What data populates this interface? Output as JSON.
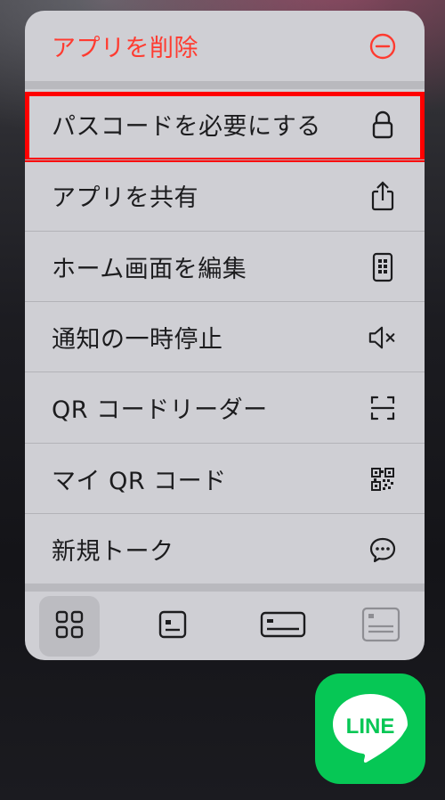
{
  "menu": {
    "delete_app": {
      "label": "アプリを削除",
      "icon": "minus-circle-icon"
    },
    "items": [
      {
        "label": "パスコードを必要にする",
        "icon": "lock-icon"
      },
      {
        "label": "アプリを共有",
        "icon": "share-icon"
      },
      {
        "label": "ホーム画面を編集",
        "icon": "phone-icon"
      },
      {
        "label": "通知の一時停止",
        "icon": "mute-icon"
      },
      {
        "label": "QR コードリーダー",
        "icon": "scan-icon"
      },
      {
        "label": "マイ QR コード",
        "icon": "qr-code-icon"
      },
      {
        "label": "新規トーク",
        "icon": "chat-bubble-icon"
      }
    ],
    "widget_sizes": [
      "small",
      "medium",
      "large",
      "extra-large"
    ]
  },
  "app": {
    "name": "LINE",
    "color": "#06c755"
  },
  "colors": {
    "destructive": "#ff3b30",
    "highlight": "#ff0000",
    "menu_bg": "#cfcfd4"
  }
}
